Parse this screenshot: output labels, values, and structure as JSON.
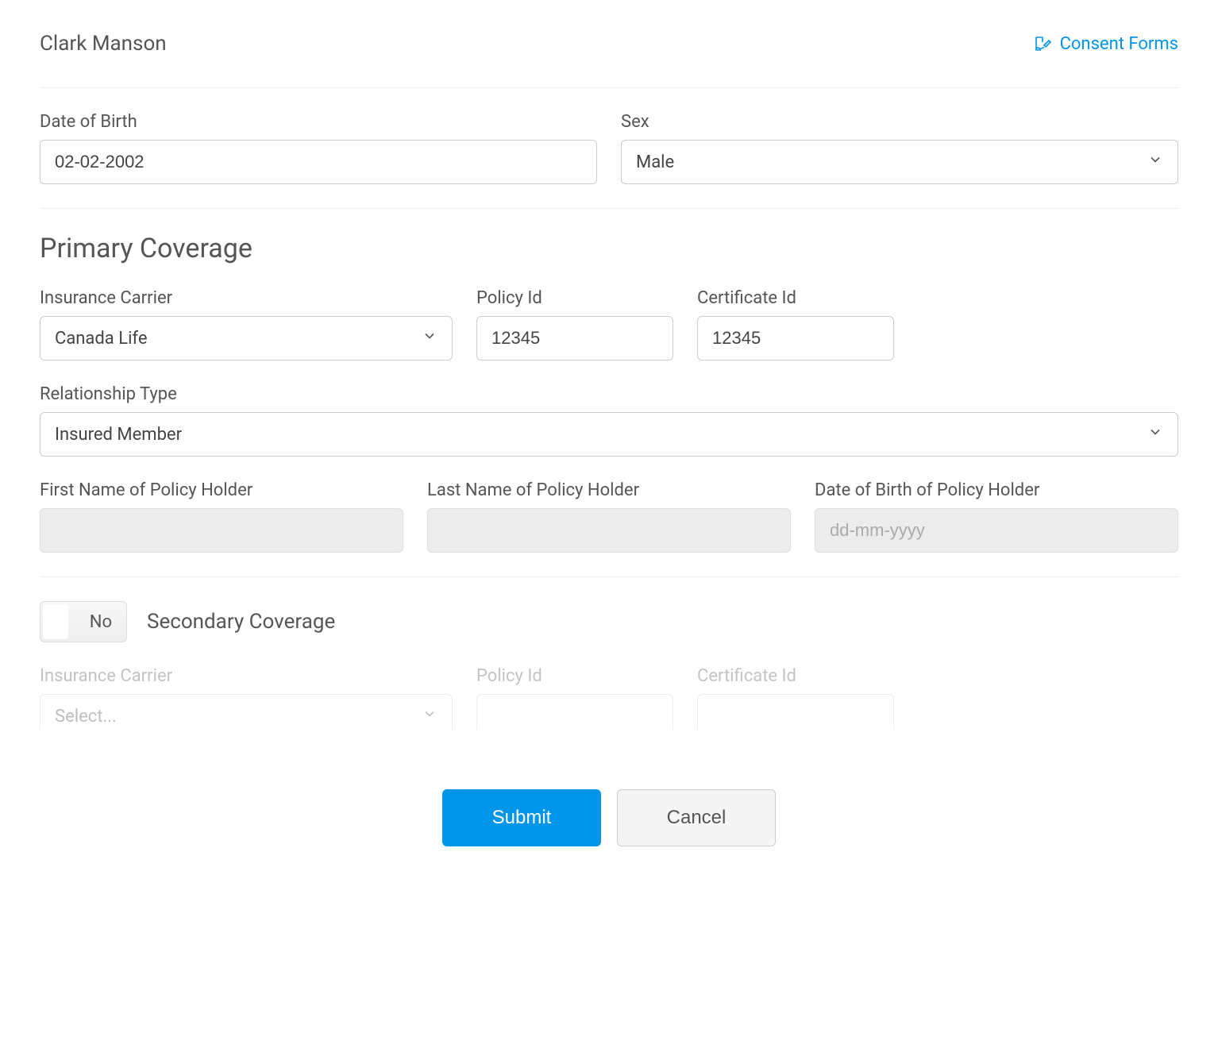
{
  "header": {
    "patient_name": "Clark Manson",
    "consent_link": "Consent Forms"
  },
  "fields": {
    "dob_label": "Date of Birth",
    "dob_value": "02-02-2002",
    "sex_label": "Sex",
    "sex_value": "Male"
  },
  "primary": {
    "title": "Primary Coverage",
    "carrier_label": "Insurance Carrier",
    "carrier_value": "Canada Life",
    "policy_label": "Policy Id",
    "policy_value": "12345",
    "cert_label": "Certificate Id",
    "cert_value": "12345",
    "rel_label": "Relationship Type",
    "rel_value": "Insured Member",
    "holder_first_label": "First Name of Policy Holder",
    "holder_first_value": "",
    "holder_last_label": "Last Name of Policy Holder",
    "holder_last_value": "",
    "holder_dob_label": "Date of Birth of Policy Holder",
    "holder_dob_placeholder": "dd-mm-yyyy"
  },
  "secondary": {
    "toggle_state": "No",
    "title": "Secondary Coverage",
    "carrier_label": "Insurance Carrier",
    "carrier_value": "Select...",
    "policy_label": "Policy Id",
    "cert_label": "Certificate Id"
  },
  "buttons": {
    "submit": "Submit",
    "cancel": "Cancel"
  }
}
